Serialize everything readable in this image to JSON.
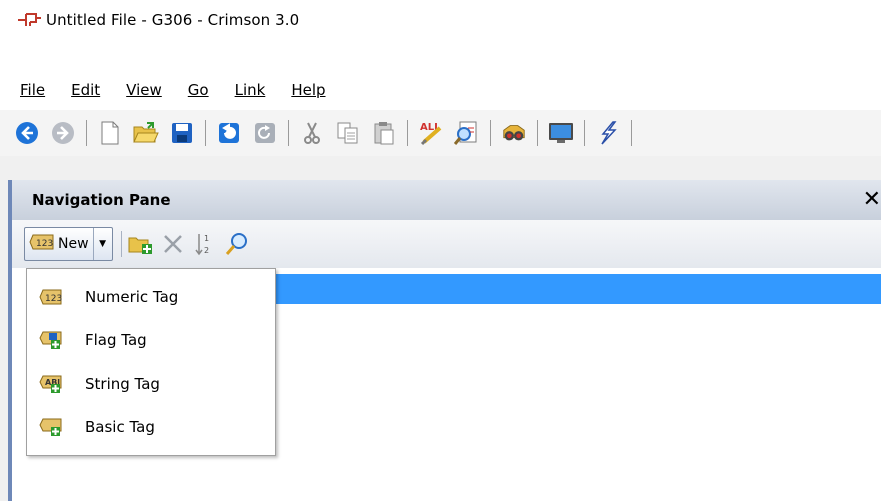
{
  "window": {
    "title": "Untitled File - G306 - Crimson 3.0"
  },
  "menu": [
    {
      "label": "File"
    },
    {
      "label": "Edit"
    },
    {
      "label": "View"
    },
    {
      "label": "Go"
    },
    {
      "label": "Link"
    },
    {
      "label": "Help"
    }
  ],
  "toolbar": {
    "icons": [
      "back-icon",
      "forward-icon",
      "new-file-icon",
      "open-folder-icon",
      "save-icon",
      "undo-icon",
      "redo-icon",
      "cut-icon",
      "copy-icon",
      "paste-icon",
      "spell-all-icon",
      "find-icon",
      "binoculars-icon",
      "monitor-icon",
      "lightning-icon"
    ]
  },
  "nav_pane": {
    "title": "Navigation Pane",
    "close_label": "✕",
    "new_button_label": "New",
    "toolbar_icons": [
      "new-folder-icon",
      "delete-icon",
      "sort-icon",
      "search-icon"
    ]
  },
  "new_menu": {
    "items": [
      {
        "label": "Numeric Tag",
        "icon": "numeric-tag-icon"
      },
      {
        "label": "Flag Tag",
        "icon": "flag-tag-icon"
      },
      {
        "label": "String Tag",
        "icon": "string-tag-icon"
      },
      {
        "label": "Basic Tag",
        "icon": "basic-tag-icon"
      }
    ]
  },
  "colors": {
    "selection": "#3399ff",
    "pane_header": "#c8d0dc",
    "accent_blue": "#1e73d8"
  }
}
